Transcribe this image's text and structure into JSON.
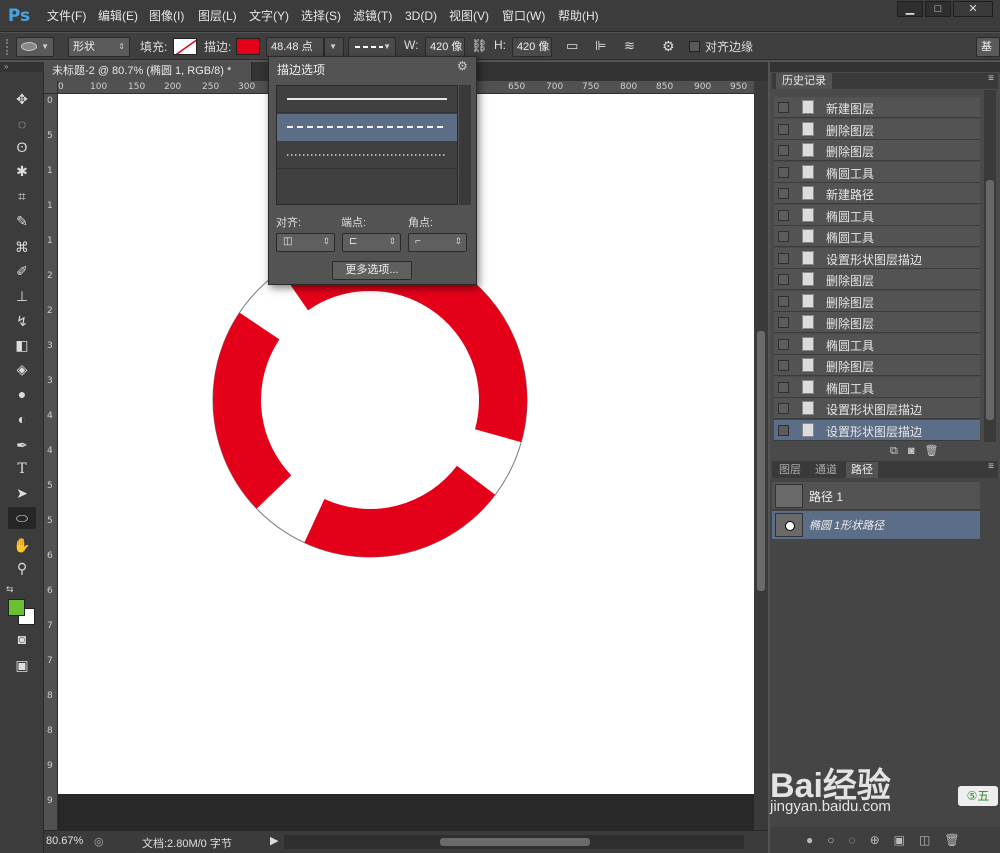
{
  "app": {
    "logo": "Ps"
  },
  "menu": [
    "文件(F)",
    "编辑(E)",
    "图像(I)",
    "图层(L)",
    "文字(Y)",
    "选择(S)",
    "滤镜(T)",
    "3D(D)",
    "视图(V)",
    "窗口(W)",
    "帮助(H)"
  ],
  "window_controls": {
    "minimize": "▁",
    "maximize": "□",
    "close": "✕"
  },
  "options_bar": {
    "mode": "形状",
    "fill_label": "填充:",
    "stroke_label": "描边:",
    "stroke_width": "48.48 点",
    "w_label": "W:",
    "w_value": "420 像",
    "h_label": "H:",
    "h_value": "420 像",
    "align_edges": "对齐边缘",
    "workspace": "基"
  },
  "document": {
    "tab_title": "未标题-2 @ 80.7% (椭圆 1, RGB/8) *",
    "zoom": "80.67%",
    "doc_info": "文档:2.80M/0 字节"
  },
  "ruler_top": [
    "0",
    "100",
    "150",
    "200",
    "250",
    "300",
    "350",
    "400",
    "450",
    "500",
    "550",
    "600",
    "650",
    "700",
    "750",
    "800",
    "850",
    "900",
    "950"
  ],
  "ruler_left": [
    "0",
    "5",
    "1",
    "1",
    "1",
    "2",
    "2",
    "3",
    "3",
    "4",
    "4",
    "5",
    "5",
    "6",
    "6",
    "7",
    "7",
    "8",
    "8",
    "9",
    "9"
  ],
  "stroke_popup": {
    "title": "描边选项",
    "align_label": "对齐:",
    "caps_label": "端点:",
    "corners_label": "角点:",
    "more_options": "更多选项..."
  },
  "history_panel": {
    "title": "历史记录",
    "items": [
      "新建图层",
      "删除图层",
      "删除图层",
      "椭圆工具",
      "新建路径",
      "椭圆工具",
      "椭圆工具",
      "设置形状图层描边",
      "删除图层",
      "删除图层",
      "删除图层",
      "椭圆工具",
      "删除图层",
      "椭圆工具",
      "设置形状图层描边",
      "设置形状图层描边"
    ]
  },
  "layers_panel": {
    "tabs": [
      "图层",
      "通道",
      "路径"
    ],
    "paths": [
      "路径 1",
      "椭圆 1形状路径"
    ]
  },
  "watermark": {
    "brand": "Bai经验",
    "url": "jingyan.baidu.com"
  },
  "colors": {
    "stroke": "#e5001a",
    "foreground": "#6bbf33",
    "background": "#ffffff",
    "selected_row": "#5c6e87"
  }
}
